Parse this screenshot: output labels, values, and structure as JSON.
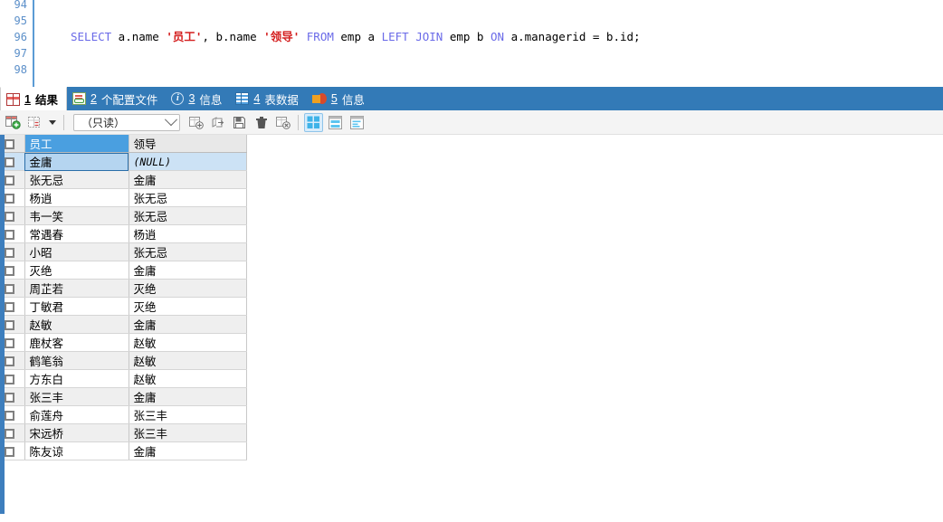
{
  "editor": {
    "line_numbers": [
      "94",
      "95",
      "96",
      "97",
      "98"
    ],
    "sql_tokens": [
      {
        "t": "SELECT",
        "c": "kw"
      },
      {
        "t": " a.name ",
        "c": "pl"
      },
      {
        "t": "'员工'",
        "c": "str"
      },
      {
        "t": ", b.name ",
        "c": "pl"
      },
      {
        "t": "'领导'",
        "c": "str"
      },
      {
        "t": " ",
        "c": "pl"
      },
      {
        "t": "FROM",
        "c": "kw"
      },
      {
        "t": " emp a ",
        "c": "pl"
      },
      {
        "t": "LEFT JOIN",
        "c": "kw"
      },
      {
        "t": " emp b ",
        "c": "pl"
      },
      {
        "t": "ON",
        "c": "kw"
      },
      {
        "t": " a.managerid = b.id;",
        "c": "pl"
      }
    ],
    "sql_plain": "SELECT a.name '员工', b.name '领导' FROM emp a LEFT JOIN emp b ON a.managerid = b.id;"
  },
  "tabs": [
    {
      "num": "1",
      "label": "结果",
      "icon": "result-grid-icon",
      "active": true
    },
    {
      "num": "2",
      "label": "个配置文件",
      "icon": "profile-icon",
      "active": false
    },
    {
      "num": "3",
      "label": "信息",
      "icon": "info-circle-icon",
      "active": false
    },
    {
      "num": "4",
      "label": "表数据",
      "icon": "table-data-icon",
      "active": false
    },
    {
      "num": "5",
      "label": "信息",
      "icon": "pie-chart-icon",
      "active": false
    }
  ],
  "toolbar": {
    "buttons": [
      {
        "name": "add-record-icon"
      },
      {
        "name": "select-range-icon"
      },
      {
        "name": "apply-changes-icon"
      },
      {
        "name": "export-icon"
      },
      {
        "name": "save-icon"
      },
      {
        "name": "delete-record-icon"
      },
      {
        "name": "cancel-changes-icon"
      }
    ],
    "mode_select": {
      "value": "（只读）",
      "placeholder": "（只读）"
    },
    "view_modes": [
      {
        "name": "grid-view-icon",
        "selected": true
      },
      {
        "name": "form-view-icon",
        "selected": false
      },
      {
        "name": "text-view-icon",
        "selected": false
      }
    ]
  },
  "grid": {
    "columns": [
      "员工",
      "领导"
    ],
    "selected_column_index": 0,
    "selected_row_index": 0,
    "rows": [
      {
        "员工": "金庸",
        "领导": "(NULL)",
        "null_b": true
      },
      {
        "员工": "张无忌",
        "领导": "金庸",
        "null_b": false
      },
      {
        "员工": "杨逍",
        "领导": "张无忌",
        "null_b": false
      },
      {
        "员工": "韦一笑",
        "领导": "张无忌",
        "null_b": false
      },
      {
        "员工": "常遇春",
        "领导": "杨逍",
        "null_b": false
      },
      {
        "员工": "小昭",
        "领导": "张无忌",
        "null_b": false
      },
      {
        "员工": "灭绝",
        "领导": "金庸",
        "null_b": false
      },
      {
        "员工": "周芷若",
        "领导": "灭绝",
        "null_b": false
      },
      {
        "员工": "丁敏君",
        "领导": "灭绝",
        "null_b": false
      },
      {
        "员工": "赵敏",
        "领导": "金庸",
        "null_b": false
      },
      {
        "员工": "鹿杖客",
        "领导": "赵敏",
        "null_b": false
      },
      {
        "员工": "鹤笔翁",
        "领导": "赵敏",
        "null_b": false
      },
      {
        "员工": "方东白",
        "领导": "赵敏",
        "null_b": false
      },
      {
        "员工": "张三丰",
        "领导": "金庸",
        "null_b": false
      },
      {
        "员工": "俞莲舟",
        "领导": "张三丰",
        "null_b": false
      },
      {
        "员工": "宋远桥",
        "领导": "张三丰",
        "null_b": false
      },
      {
        "员工": "陈友谅",
        "领导": "金庸",
        "null_b": false
      }
    ]
  },
  "colors": {
    "tabbar_blue": "#337ab7",
    "header_select_blue": "#4a9fe0",
    "row_select_blue": "#cce2f5",
    "toolbar_bg": "#f4f4f4",
    "row_alt_gray": "#efefef",
    "sql_keyword": "#6a6ae8",
    "sql_string": "#d42020",
    "line_number": "#5b8fc9"
  }
}
